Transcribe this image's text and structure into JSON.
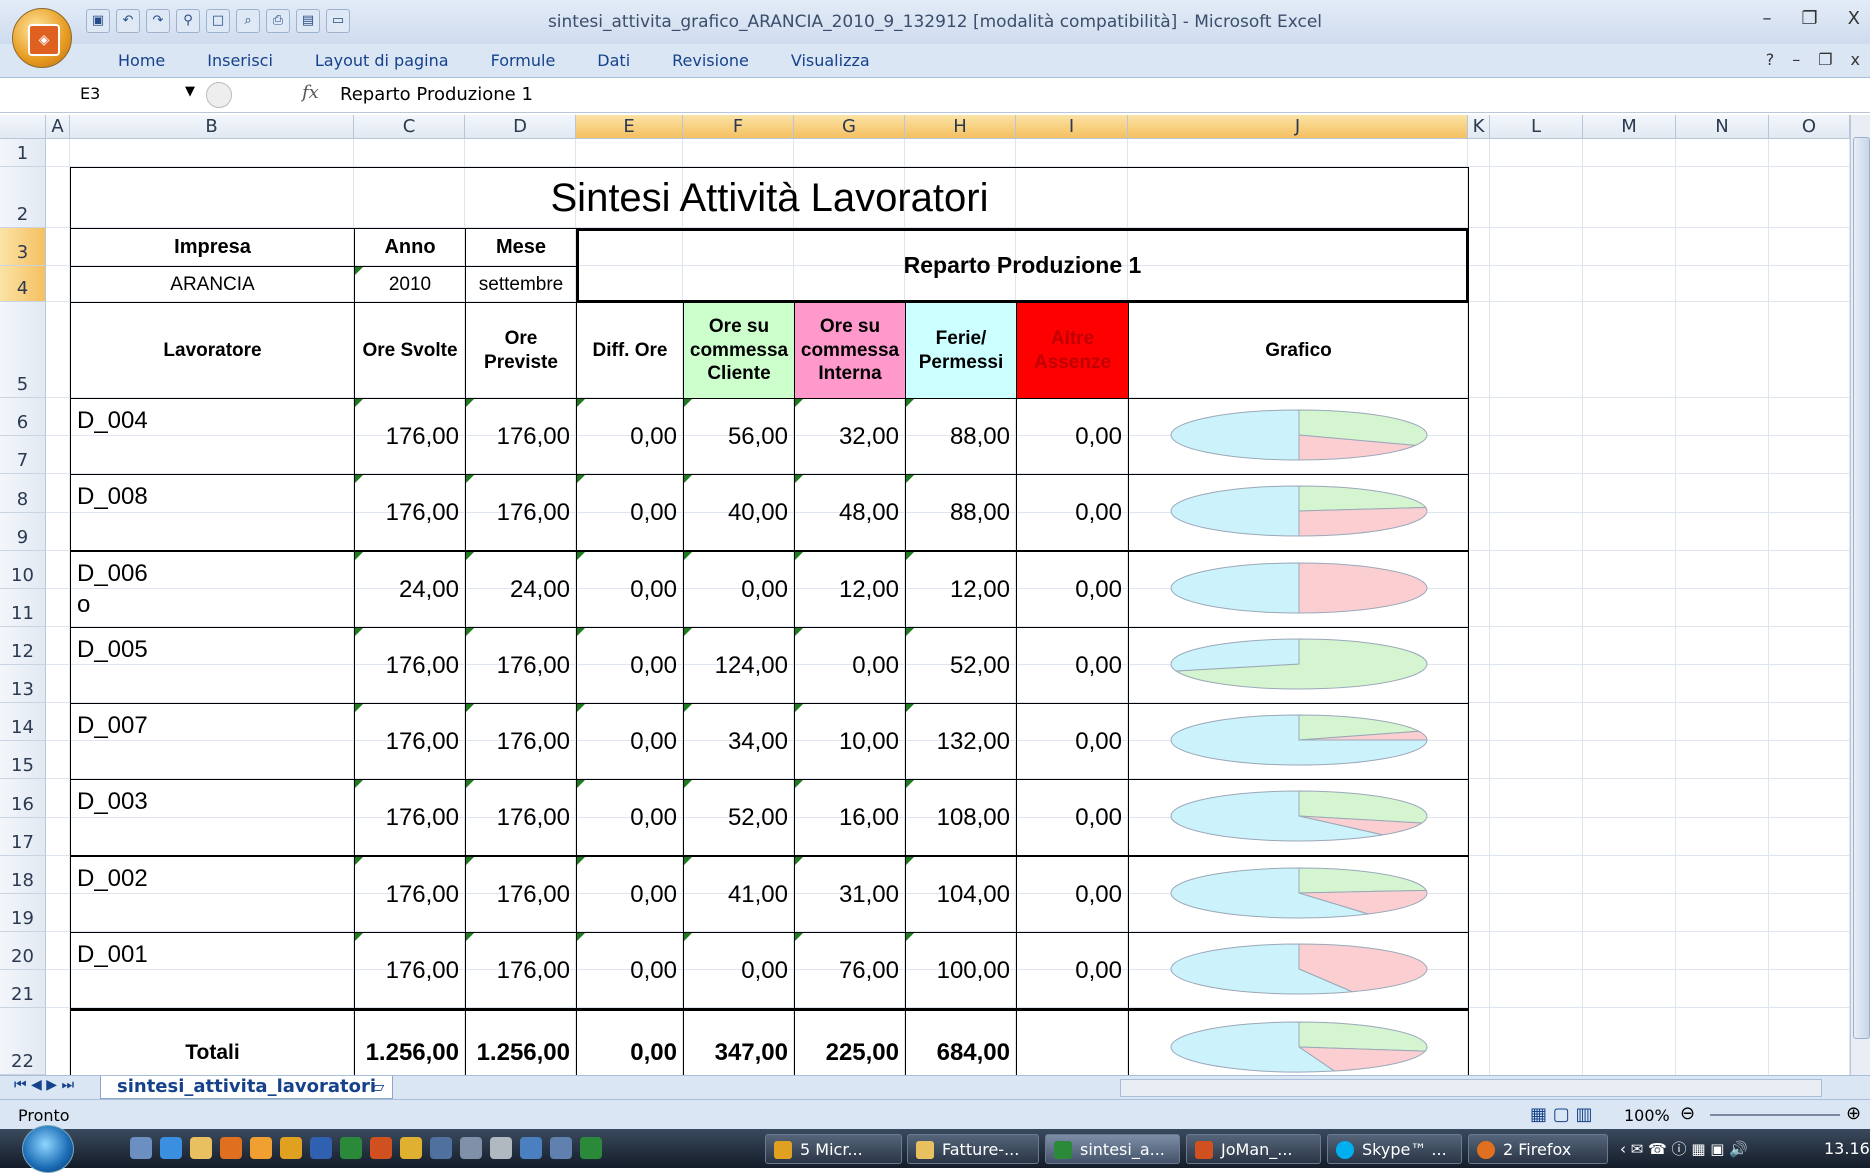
{
  "window": {
    "title": "sintesi_attivita_grafico_ARANCIA_2010_9_132912  [modalità compatibilità] - Microsoft Excel",
    "minimize": "–",
    "restore": "❐",
    "close": "X"
  },
  "ribbon": {
    "tabs": [
      "Home",
      "Inserisci",
      "Layout di pagina",
      "Formule",
      "Dati",
      "Revisione",
      "Visualizza"
    ]
  },
  "formula_bar": {
    "name_box": "E3",
    "fx": "fx",
    "value": "Reparto Produzione 1"
  },
  "columns": [
    "A",
    "B",
    "C",
    "D",
    "E",
    "F",
    "G",
    "H",
    "I",
    "J",
    "K",
    "L",
    "M",
    "N",
    "O"
  ],
  "rows": [
    "1",
    "2",
    "3",
    "4",
    "5",
    "6",
    "7",
    "8",
    "9",
    "10",
    "11",
    "12",
    "13",
    "14",
    "15",
    "16",
    "17",
    "18",
    "19",
    "20",
    "21",
    "22"
  ],
  "sheet": {
    "title": "Sintesi Attività Lavoratori",
    "impresa_label": "Impresa",
    "impresa_value": "ARANCIA",
    "anno_label": "Anno",
    "anno_value": "2010",
    "mese_label": "Mese",
    "mese_value": "settembre",
    "reparto": "Reparto Produzione 1",
    "headers": {
      "lavoratore": "Lavoratore",
      "ore_svolte": "Ore Svolte",
      "ore_previste": "Ore Previste",
      "diff_ore": "Diff. Ore",
      "ore_cliente": "Ore su commessa Cliente",
      "ore_interna": "Ore su commessa Interna",
      "ferie": "Ferie/ Permessi",
      "altre_assenze": "Altre Assenze",
      "grafico": "Grafico"
    },
    "header_colors": {
      "cliente": "#ccffcc",
      "interna": "#ff99cc",
      "ferie": "#ccffff",
      "assenze": "#ff0000"
    },
    "pie_colors": {
      "ferie": "#ccf2fb",
      "cliente": "#d5f5d0",
      "interna": "#fbcfd1"
    },
    "workers": [
      {
        "name": "D_004",
        "ore_svolte": "176,00",
        "ore_previste": "176,00",
        "diff": "0,00",
        "cliente": "56,00",
        "interna": "32,00",
        "ferie": "88,00",
        "assenze": "0,00"
      },
      {
        "name": "D_008",
        "ore_svolte": "176,00",
        "ore_previste": "176,00",
        "diff": "0,00",
        "cliente": "40,00",
        "interna": "48,00",
        "ferie": "88,00",
        "assenze": "0,00"
      },
      {
        "name": "D_006\no",
        "ore_svolte": "24,00",
        "ore_previste": "24,00",
        "diff": "0,00",
        "cliente": "0,00",
        "interna": "12,00",
        "ferie": "12,00",
        "assenze": "0,00"
      },
      {
        "name": "D_005",
        "ore_svolte": "176,00",
        "ore_previste": "176,00",
        "diff": "0,00",
        "cliente": "124,00",
        "interna": "0,00",
        "ferie": "52,00",
        "assenze": "0,00"
      },
      {
        "name": "D_007",
        "ore_svolte": "176,00",
        "ore_previste": "176,00",
        "diff": "0,00",
        "cliente": "34,00",
        "interna": "10,00",
        "ferie": "132,00",
        "assenze": "0,00"
      },
      {
        "name": "D_003",
        "ore_svolte": "176,00",
        "ore_previste": "176,00",
        "diff": "0,00",
        "cliente": "52,00",
        "interna": "16,00",
        "ferie": "108,00",
        "assenze": "0,00"
      },
      {
        "name": "D_002",
        "ore_svolte": "176,00",
        "ore_previste": "176,00",
        "diff": "0,00",
        "cliente": "41,00",
        "interna": "31,00",
        "ferie": "104,00",
        "assenze": "0,00"
      },
      {
        "name": "D_001",
        "ore_svolte": "176,00",
        "ore_previste": "176,00",
        "diff": "0,00",
        "cliente": "0,00",
        "interna": "76,00",
        "ferie": "100,00",
        "assenze": "0,00"
      }
    ],
    "totals": {
      "label": "Totali",
      "ore_svolte": "1.256,00",
      "ore_previste": "1.256,00",
      "diff": "0,00",
      "cliente": "347,00",
      "interna": "225,00",
      "ferie": "684,00",
      "assenze": ""
    }
  },
  "chart_data": {
    "type": "pie",
    "series_order": [
      "Ore su commessa Cliente",
      "Ore su commessa Interna",
      "Ferie/ Permessi",
      "Altre Assenze"
    ],
    "pies": [
      {
        "row": "D_004",
        "values": [
          56,
          32,
          88,
          0
        ]
      },
      {
        "row": "D_008",
        "values": [
          40,
          48,
          88,
          0
        ]
      },
      {
        "row": "D_006",
        "values": [
          0,
          12,
          12,
          0
        ]
      },
      {
        "row": "D_005",
        "values": [
          124,
          0,
          52,
          0
        ]
      },
      {
        "row": "D_007",
        "values": [
          34,
          10,
          132,
          0
        ]
      },
      {
        "row": "D_003",
        "values": [
          52,
          16,
          108,
          0
        ]
      },
      {
        "row": "D_002",
        "values": [
          41,
          31,
          104,
          0
        ]
      },
      {
        "row": "D_001",
        "values": [
          0,
          76,
          100,
          0
        ]
      },
      {
        "row": "Totali",
        "values": [
          347,
          225,
          684,
          0
        ]
      }
    ]
  },
  "sheet_tabs": {
    "active": "sintesi_attivita_lavoratori"
  },
  "status": {
    "text": "Pronto",
    "zoom": "100%"
  },
  "taskbar": {
    "items": [
      "5 Micr...",
      "Fatture-...",
      "sintesi_a...",
      "JoMan_...",
      "Skype™ ...",
      "2 Firefox"
    ],
    "clock": "13.16"
  }
}
